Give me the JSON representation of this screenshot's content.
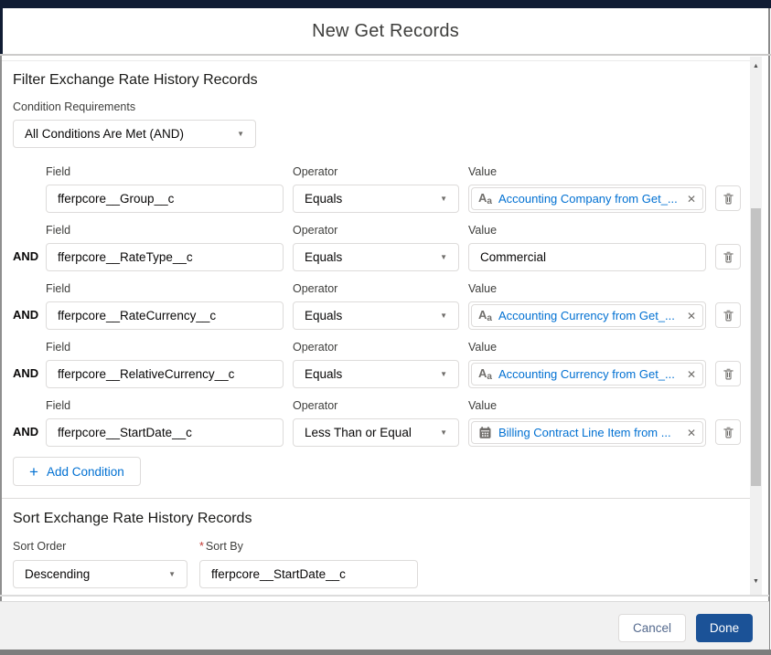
{
  "modal": {
    "title": "New Get Records",
    "filter": {
      "heading": "Filter Exchange Rate History Records",
      "condition_requirements": {
        "label": "Condition Requirements",
        "selected": "All Conditions Are Met (AND)"
      },
      "columns": {
        "field": "Field",
        "operator": "Operator",
        "value": "Value"
      },
      "rows": [
        {
          "join": "",
          "field": "fferpcore__Group__c",
          "operator": "Equals",
          "value": "Accounting Company from Get_...",
          "value_kind": "resource-pill",
          "value_icon": "text-type-icon"
        },
        {
          "join": "AND",
          "field": "fferpcore__RateType__c",
          "operator": "Equals",
          "value": "Commercial",
          "value_kind": "plain-text",
          "value_icon": ""
        },
        {
          "join": "AND",
          "field": "fferpcore__RateCurrency__c",
          "operator": "Equals",
          "value": "Accounting Currency from Get_...",
          "value_kind": "resource-pill",
          "value_icon": "text-type-icon"
        },
        {
          "join": "AND",
          "field": "fferpcore__RelativeCurrency__c",
          "operator": "Equals",
          "value": "Accounting Currency from Get_...",
          "value_kind": "resource-pill",
          "value_icon": "text-type-icon"
        },
        {
          "join": "AND",
          "field": "fferpcore__StartDate__c",
          "operator": "Less Than or Equal",
          "value": "Billing Contract Line Item from ...",
          "value_kind": "resource-pill",
          "value_icon": "calendar-icon"
        }
      ],
      "add_condition": "Add Condition"
    },
    "sort": {
      "heading": "Sort Exchange Rate History Records",
      "sort_order": {
        "label": "Sort Order",
        "selected": "Descending"
      },
      "sort_by": {
        "label": "Sort By",
        "required_mark": "*",
        "value": "fferpcore__StartDate__c"
      }
    },
    "footer": {
      "cancel": "Cancel",
      "done": "Done"
    },
    "icons": {
      "remove_value": "close-icon",
      "delete_row": "trash-icon",
      "dropdown": "chevron-down-icon"
    },
    "colors": {
      "accent_blue": "#0070d2",
      "brand_button": "#1b5297",
      "header_bar": "#101c33",
      "required_red": "#c23934",
      "footer_bg": "#f1f1f1"
    }
  }
}
